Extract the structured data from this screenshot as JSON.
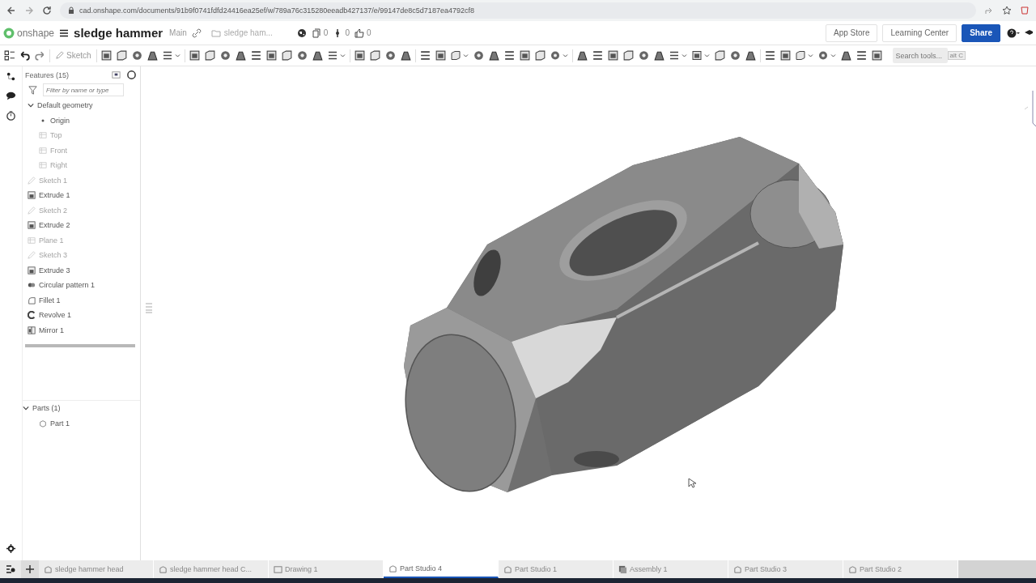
{
  "browser": {
    "url": "cad.onshape.com/documents/91b9f0741fdfd24416ea25ef/w/789a76c315280eeadb427137/e/99147de8c5d7187ea4792cf8"
  },
  "header": {
    "logo": "onshape",
    "title": "sledge hammer",
    "branch": "Main",
    "folder": "sledge ham...",
    "versions": "0",
    "branches": "0",
    "likes": "0",
    "buttons": [
      {
        "label": "App Store",
        "kind": "plain"
      },
      {
        "label": "Learning Center",
        "kind": "plain"
      },
      {
        "label": "Share",
        "kind": "primary"
      }
    ]
  },
  "toolbar": {
    "sketch": "Sketch",
    "search": {
      "placeholder": "Search tools...",
      "shortcut": "alt C"
    }
  },
  "features": {
    "title": "Features (15)",
    "filter": {
      "placeholder": "Filter by name or type"
    },
    "items": [
      {
        "label": "Default geometry",
        "kind": "folder",
        "disabled": false,
        "expanded": true,
        "children": [
          {
            "label": "Origin",
            "kind": "origin",
            "disabled": false
          },
          {
            "label": "Top",
            "kind": "plane",
            "disabled": true
          },
          {
            "label": "Front",
            "kind": "plane",
            "disabled": true
          },
          {
            "label": "Right",
            "kind": "plane",
            "disabled": true
          }
        ]
      },
      {
        "label": "Sketch 1",
        "kind": "sketch",
        "disabled": true
      },
      {
        "label": "Extrude 1",
        "kind": "extrude",
        "disabled": false
      },
      {
        "label": "Sketch 2",
        "kind": "sketch",
        "disabled": true
      },
      {
        "label": "Extrude 2",
        "kind": "extrude",
        "disabled": false
      },
      {
        "label": "Plane 1",
        "kind": "plane",
        "disabled": true
      },
      {
        "label": "Sketch 3",
        "kind": "sketch",
        "disabled": true
      },
      {
        "label": "Extrude 3",
        "kind": "extrude",
        "disabled": false
      },
      {
        "label": "Circular pattern 1",
        "kind": "pattern",
        "disabled": false
      },
      {
        "label": "Fillet 1",
        "kind": "fillet",
        "disabled": false
      },
      {
        "label": "Revolve 1",
        "kind": "revolve",
        "disabled": false
      },
      {
        "label": "Mirror 1",
        "kind": "mirror",
        "disabled": false
      }
    ]
  },
  "parts": {
    "title": "Parts (1)",
    "expanded": true,
    "items": [
      {
        "label": "Part 1"
      }
    ]
  },
  "tabs": [
    {
      "label": "sledge hammer head",
      "kind": "part",
      "selected": false
    },
    {
      "label": "sledge hammer head C...",
      "kind": "part",
      "selected": false
    },
    {
      "label": "Drawing 1",
      "kind": "drawing",
      "selected": false
    },
    {
      "label": "Part Studio 4",
      "kind": "part",
      "selected": true
    },
    {
      "label": "Part Studio 1",
      "kind": "part",
      "selected": false
    },
    {
      "label": "Assembly 1",
      "kind": "assembly",
      "selected": false
    },
    {
      "label": "Part Studio 3",
      "kind": "part",
      "selected": false
    },
    {
      "label": "Part Studio 2",
      "kind": "part",
      "selected": false
    }
  ]
}
